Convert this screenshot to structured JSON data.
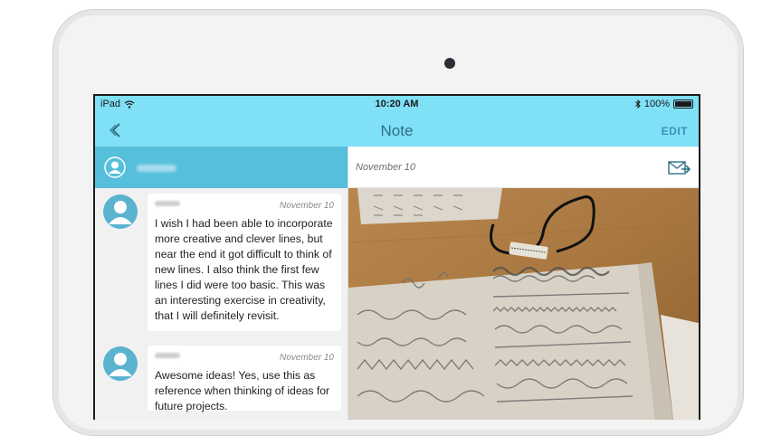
{
  "status_bar": {
    "carrier": "iPad",
    "time": "10:20 AM",
    "battery": "100%"
  },
  "nav": {
    "title": "Note",
    "edit_label": "EDIT"
  },
  "note": {
    "date": "November 10"
  },
  "comments": [
    {
      "date": "November 10",
      "text": "I wish I had been able to incorporate more creative and clever lines, but near the end it got difficult to think of new lines. I also think the first few lines I did were too basic. This was an interesting exercise in creativity, that I will definitely revisit."
    },
    {
      "date": "November 10",
      "text": "Awesome ideas!  Yes, use this as reference when thinking of ideas for future projects."
    }
  ],
  "colors": {
    "nav_bg": "#7fe0f6",
    "user_bar": "#56bfdc",
    "avatar": "#5ab3cf",
    "accent_text": "#3a92b6"
  },
  "icons": {
    "back": "chevron-left-icon",
    "wifi": "wifi-icon",
    "bluetooth": "bluetooth-icon",
    "battery": "battery-icon",
    "share": "mail-share-icon",
    "avatar": "user-avatar-icon"
  }
}
